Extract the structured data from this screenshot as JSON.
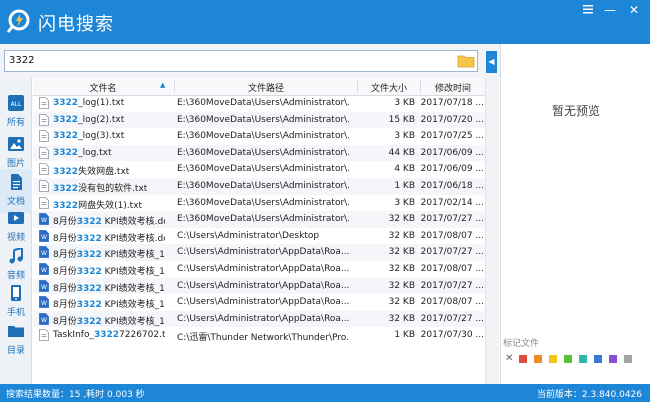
{
  "app": {
    "title": "闪电搜索"
  },
  "window": {
    "menu_icon": "menu-icon",
    "min": "—",
    "close": "✕"
  },
  "search": {
    "value": "3322"
  },
  "sidebar": {
    "items": [
      {
        "label": "所有",
        "icon": "all-icon"
      },
      {
        "label": "图片",
        "icon": "image-icon"
      },
      {
        "label": "文档",
        "icon": "document-icon"
      },
      {
        "label": "视频",
        "icon": "video-icon"
      },
      {
        "label": "音频",
        "icon": "audio-icon"
      },
      {
        "label": "手机",
        "icon": "phone-icon"
      },
      {
        "label": "目录",
        "icon": "folder-icon"
      }
    ]
  },
  "table": {
    "headers": {
      "name": "文件名",
      "path": "文件路径",
      "size": "文件大小",
      "time": "修改时间"
    },
    "rows": [
      {
        "hl": "3322",
        "rest": "_log(1).txt",
        "path": "E:\\360MoveData\\Users\\Administrator\\...",
        "size": "3 KB",
        "time": "2017/07/18 ...",
        "icon": "txt-file-icon"
      },
      {
        "hl": "3322",
        "rest": "_log(2).txt",
        "path": "E:\\360MoveData\\Users\\Administrator\\...",
        "size": "15 KB",
        "time": "2017/07/20 ...",
        "icon": "txt-file-icon"
      },
      {
        "hl": "3322",
        "rest": "_log(3).txt",
        "path": "E:\\360MoveData\\Users\\Administrator\\...",
        "size": "3 KB",
        "time": "2017/07/25 ...",
        "icon": "txt-file-icon"
      },
      {
        "hl": "3322",
        "rest": "_log.txt",
        "path": "E:\\360MoveData\\Users\\Administrator\\...",
        "size": "44 KB",
        "time": "2017/06/09 ...",
        "icon": "txt-file-icon"
      },
      {
        "hl": "3322",
        "rest": "失效网盘.txt",
        "path": "E:\\360MoveData\\Users\\Administrator\\...",
        "size": "4 KB",
        "time": "2017/06/09 ...",
        "icon": "txt-file-icon"
      },
      {
        "hl": "3322",
        "rest": "没有包的软件.txt",
        "path": "E:\\360MoveData\\Users\\Administrator\\...",
        "size": "1 KB",
        "time": "2017/06/18 ...",
        "icon": "txt-file-icon"
      },
      {
        "hl": "3322",
        "rest": "网盘失效(1).txt",
        "path": "E:\\360MoveData\\Users\\Administrator\\...",
        "size": "3 KB",
        "time": "2017/02/14 ...",
        "icon": "txt-file-icon"
      },
      {
        "pre": "8月份",
        "hl": "3322",
        "rest": " KPI绩效考核.doc",
        "path": "E:\\360MoveData\\Users\\Administrator\\...",
        "size": "32 KB",
        "time": "2017/07/27 ...",
        "icon": "doc-file-icon"
      },
      {
        "pre": "8月份",
        "hl": "3322",
        "rest": " KPI绩效考核.doc",
        "path": "C:\\Users\\Administrator\\Desktop",
        "size": "32 KB",
        "time": "2017/08/07 ...",
        "icon": "doc-file-icon"
      },
      {
        "pre": "8月份",
        "hl": "3322",
        "rest": " KPI绩效考核_150...",
        "path": "C:\\Users\\Administrator\\AppData\\Roa...",
        "size": "32 KB",
        "time": "2017/07/27 ...",
        "icon": "doc-file-icon"
      },
      {
        "pre": "8月份",
        "hl": "3322",
        "rest": " KPI绩效考核_150...",
        "path": "C:\\Users\\Administrator\\AppData\\Roa...",
        "size": "32 KB",
        "time": "2017/08/07 ...",
        "icon": "doc-file-icon"
      },
      {
        "pre": "8月份",
        "hl": "3322",
        "rest": " KPI绩效考核_150...",
        "path": "C:\\Users\\Administrator\\AppData\\Roa...",
        "size": "32 KB",
        "time": "2017/07/27 ...",
        "icon": "doc-file-icon"
      },
      {
        "pre": "8月份",
        "hl": "3322",
        "rest": " KPI绩效考核_150...",
        "path": "C:\\Users\\Administrator\\AppData\\Roa...",
        "size": "32 KB",
        "time": "2017/08/07 ...",
        "icon": "doc-file-icon"
      },
      {
        "pre": "8月份",
        "hl": "3322",
        "rest": " KPI绩效考核_150...",
        "path": "C:\\Users\\Administrator\\AppData\\Roa...",
        "size": "32 KB",
        "time": "2017/07/27 ...",
        "icon": "doc-file-icon"
      },
      {
        "pre": "TaskInfo_",
        "hl": "3322",
        "rest": "7226702.txt",
        "path": "C:\\迅雷\\Thunder Network\\Thunder\\Pro...",
        "size": "1 KB",
        "time": "2017/07/30 ...",
        "icon": "txt-file-icon"
      }
    ]
  },
  "preview": {
    "text": "暂无预览"
  },
  "tags": {
    "label": "标记文件",
    "clear": "✕",
    "colors": [
      "#e04b3a",
      "#f08a24",
      "#f2c318",
      "#5bbf3a",
      "#2fb8b0",
      "#3a79d8",
      "#8a4fd0",
      "#a5a5a5"
    ]
  },
  "status": {
    "left": "搜索结果数量：15 ,耗时 0.003 秒",
    "right": "当前版本：2.3.840.0426"
  },
  "colors": {
    "accent": "#1d86d6",
    "highlight": "#1d86d6"
  }
}
